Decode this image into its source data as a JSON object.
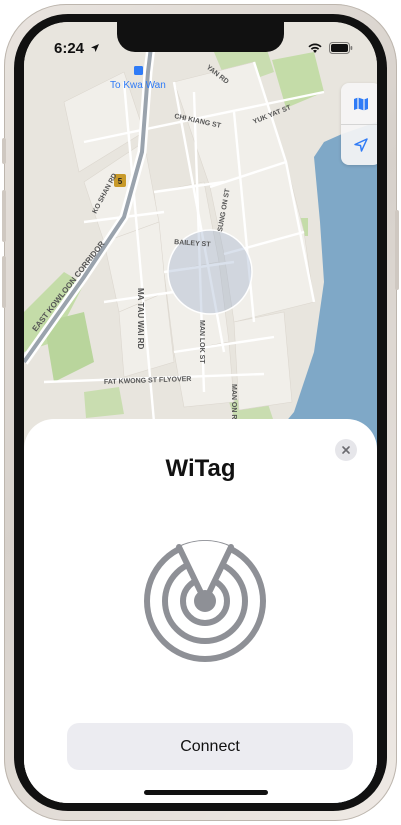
{
  "status_bar": {
    "time": "6:24"
  },
  "map": {
    "labels": {
      "to_kwa_wan": "To Kwa Wan",
      "corridor": "EAST KOWLOON CORRIDOR",
      "ko_shan_rd": "KO SHAN RD",
      "chi_kiang_st": "CHI KIANG ST",
      "yuk_yat_st": "YUK YAT ST",
      "sung_on_st": "SUNG ON ST",
      "bailey_st": "BAILEY ST",
      "ma_tau_wai_rd": "MA TAU WAI RD",
      "man_lok_st": "MAN LOK ST",
      "fat_kwong_flyover": "FAT KWONG ST FLYOVER",
      "man_on_rd": "MAN ON RD",
      "route_shield": "5",
      "yan_rd": "YAN RD"
    }
  },
  "sheet": {
    "title": "WiTag",
    "connect_label": "Connect"
  },
  "icons": {
    "location_arrow": "location-arrow-icon",
    "wifi": "wifi-icon",
    "battery": "battery-icon",
    "map_mode": "map-icon",
    "navigate": "navigation-arrow-icon",
    "close": "close-icon",
    "radar": "radar-icon"
  },
  "colors": {
    "water": "#7FA8C7",
    "park": "#BFD8A4",
    "road": "#FFFFFF",
    "sheet_bg": "#FFFFFF",
    "button_bg": "#ECECF1",
    "accent_blue": "#2F7BF6",
    "radar_gray": "#8E9096"
  }
}
